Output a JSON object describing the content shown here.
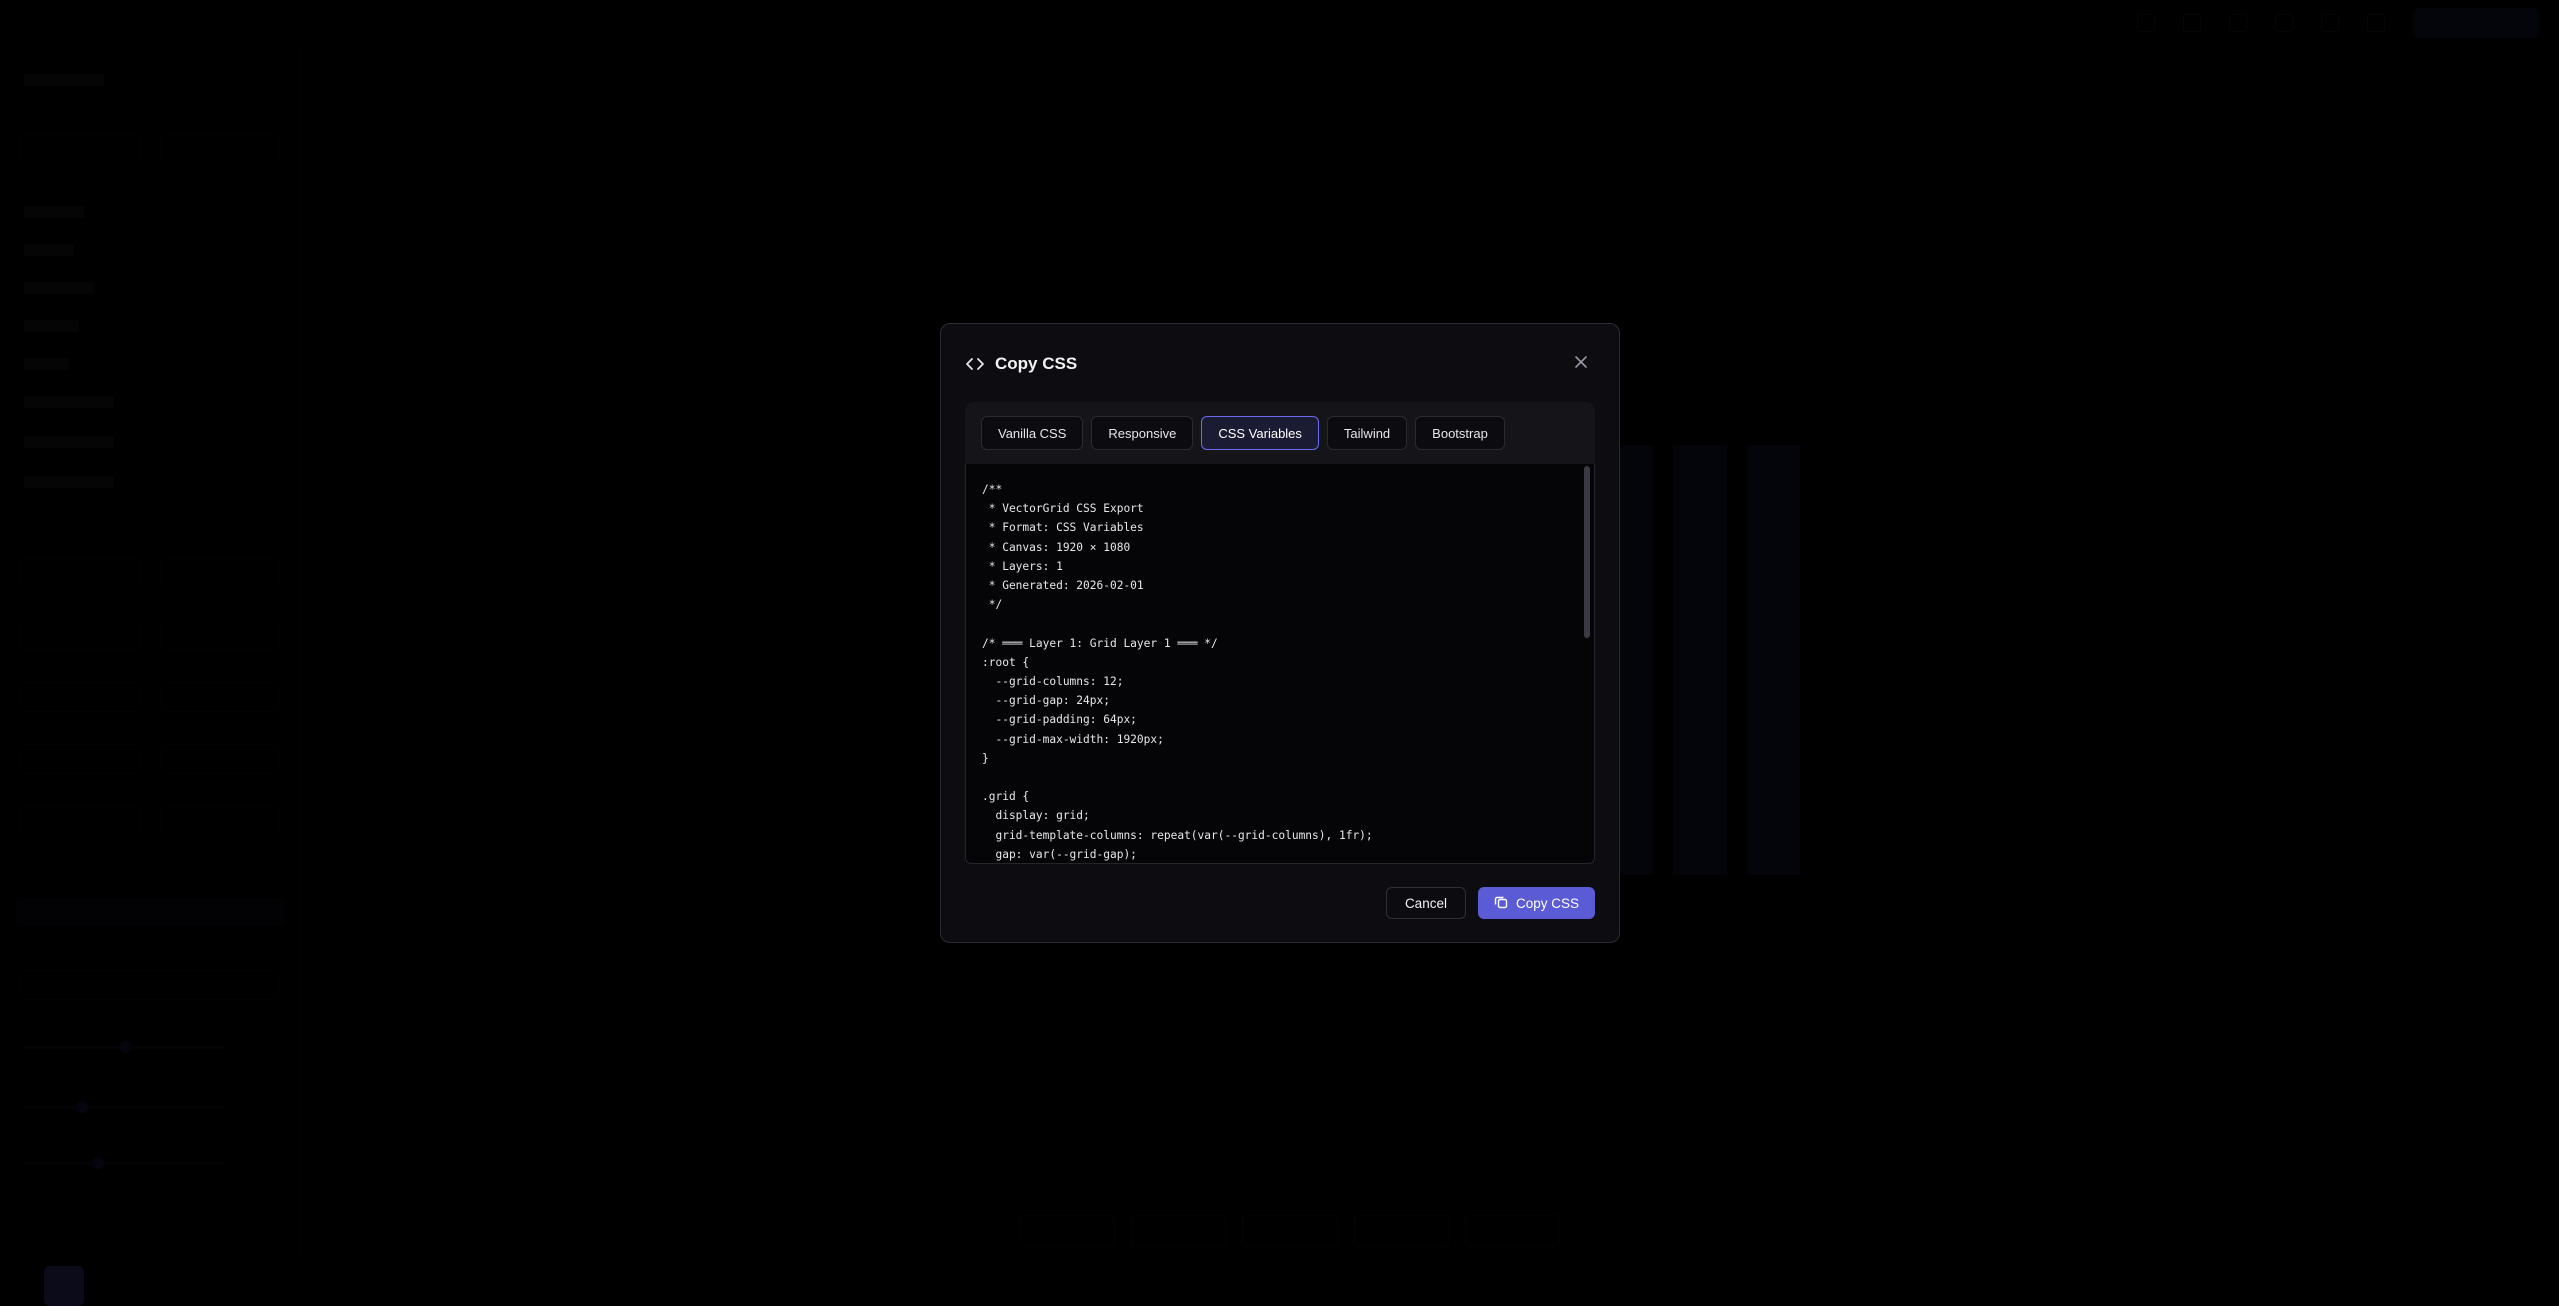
{
  "modal": {
    "title": "Copy CSS",
    "tabs": [
      {
        "label": "Vanilla CSS",
        "active": false
      },
      {
        "label": "Responsive",
        "active": false
      },
      {
        "label": "CSS Variables",
        "active": true
      },
      {
        "label": "Tailwind",
        "active": false
      },
      {
        "label": "Bootstrap",
        "active": false
      }
    ],
    "code": "/**\n * VectorGrid CSS Export\n * Format: CSS Variables\n * Canvas: 1920 × 1080\n * Layers: 1\n * Generated: 2026-02-01\n */\n\n/* ═══ Layer 1: Grid Layer 1 ═══ */\n:root {\n  --grid-columns: 12;\n  --grid-gap: 24px;\n  --grid-padding: 64px;\n  --grid-max-width: 1920px;\n}\n\n.grid {\n  display: grid;\n  grid-template-columns: repeat(var(--grid-columns), 1fr);\n  gap: var(--grid-gap);",
    "cancel_label": "Cancel",
    "copy_label": "Copy CSS",
    "icons": {
      "header": "code-icon",
      "close": "close-icon",
      "copy": "copy-icon"
    }
  },
  "colors": {
    "accent": "#5b5bd6",
    "active_tab_border": "#6b6bf0",
    "modal_bg": "#0c0c11",
    "page_bg": "#000000"
  }
}
